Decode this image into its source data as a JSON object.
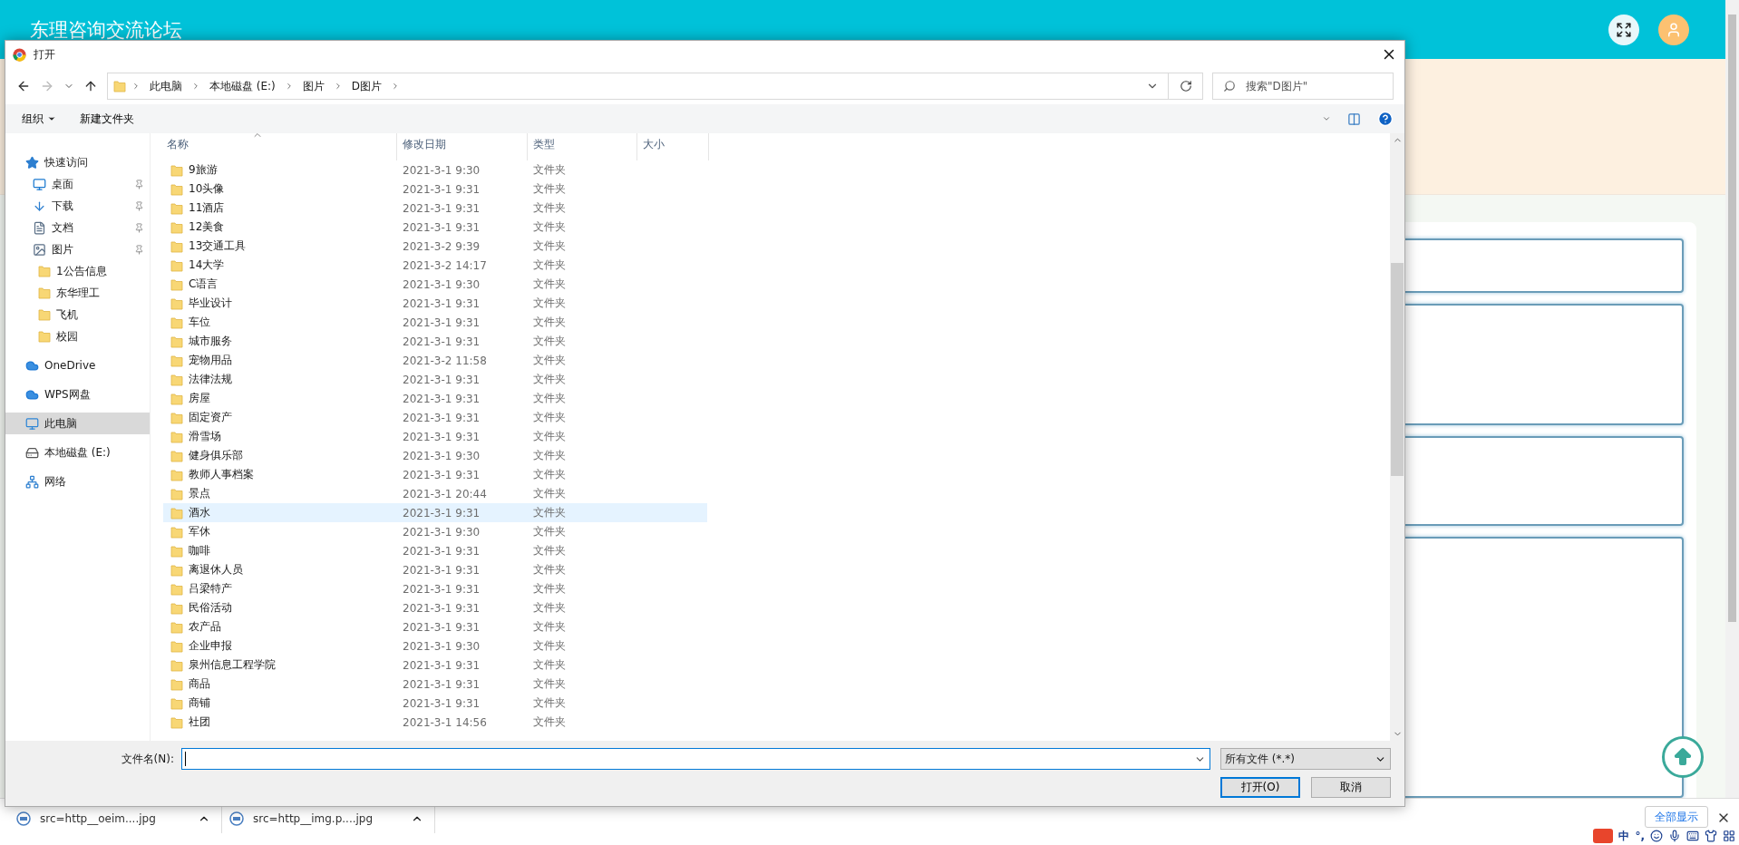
{
  "page": {
    "site_title": "东理咨询交流论坛"
  },
  "dialog": {
    "title": "打开",
    "breadcrumb": [
      "此电脑",
      "本地磁盘 (E:)",
      "图片",
      "D图片"
    ],
    "search": {
      "placeholder": "搜索\"D图片\""
    },
    "toolbar": {
      "organize": "组织",
      "new_folder": "新建文件夹"
    },
    "sidebar": [
      {
        "label": "快速访问",
        "kind": "quick",
        "selected": false,
        "children": [
          {
            "label": "桌面",
            "kind": "desktop",
            "pinned": true,
            "selected": false
          },
          {
            "label": "下载",
            "kind": "download",
            "pinned": true,
            "selected": false
          },
          {
            "label": "文档",
            "kind": "document",
            "pinned": true,
            "selected": false
          },
          {
            "label": "图片",
            "kind": "picture",
            "pinned": true,
            "selected": false
          },
          {
            "label": "1公告信息",
            "kind": "folder",
            "pinned": false,
            "selected": false
          },
          {
            "label": "东华理工",
            "kind": "folder",
            "pinned": false,
            "selected": false
          },
          {
            "label": "飞机",
            "kind": "folder",
            "pinned": false,
            "selected": false
          },
          {
            "label": "校园",
            "kind": "folder",
            "pinned": false,
            "selected": false
          }
        ]
      },
      {
        "label": "OneDrive",
        "kind": "cloud",
        "selected": false
      },
      {
        "label": "WPS网盘",
        "kind": "cloud",
        "selected": false
      },
      {
        "label": "此电脑",
        "kind": "pc",
        "selected": true
      },
      {
        "label": "本地磁盘 (E:)",
        "kind": "drive",
        "selected": false
      },
      {
        "label": "网络",
        "kind": "network",
        "selected": false
      }
    ],
    "columns": [
      "名称",
      "修改日期",
      "类型",
      "大小"
    ],
    "rows": [
      {
        "name": "9旅游",
        "modified": "2021-3-1 9:30",
        "type": "文件夹",
        "hovered": false
      },
      {
        "name": "10头像",
        "modified": "2021-3-1 9:31",
        "type": "文件夹",
        "hovered": false
      },
      {
        "name": "11酒店",
        "modified": "2021-3-1 9:31",
        "type": "文件夹",
        "hovered": false
      },
      {
        "name": "12美食",
        "modified": "2021-3-1 9:31",
        "type": "文件夹",
        "hovered": false
      },
      {
        "name": "13交通工具",
        "modified": "2021-3-2 9:39",
        "type": "文件夹",
        "hovered": false
      },
      {
        "name": "14大学",
        "modified": "2021-3-2 14:17",
        "type": "文件夹",
        "hovered": false
      },
      {
        "name": "C语言",
        "modified": "2021-3-1 9:30",
        "type": "文件夹",
        "hovered": false
      },
      {
        "name": "毕业设计",
        "modified": "2021-3-1 9:31",
        "type": "文件夹",
        "hovered": false
      },
      {
        "name": "车位",
        "modified": "2021-3-1 9:31",
        "type": "文件夹",
        "hovered": false
      },
      {
        "name": "城市服务",
        "modified": "2021-3-1 9:31",
        "type": "文件夹",
        "hovered": false
      },
      {
        "name": "宠物用品",
        "modified": "2021-3-2 11:58",
        "type": "文件夹",
        "hovered": false
      },
      {
        "name": "法律法规",
        "modified": "2021-3-1 9:31",
        "type": "文件夹",
        "hovered": false
      },
      {
        "name": "房屋",
        "modified": "2021-3-1 9:31",
        "type": "文件夹",
        "hovered": false
      },
      {
        "name": "固定资产",
        "modified": "2021-3-1 9:31",
        "type": "文件夹",
        "hovered": false
      },
      {
        "name": "滑雪场",
        "modified": "2021-3-1 9:31",
        "type": "文件夹",
        "hovered": false
      },
      {
        "name": "健身俱乐部",
        "modified": "2021-3-1 9:30",
        "type": "文件夹",
        "hovered": false
      },
      {
        "name": "教师人事档案",
        "modified": "2021-3-1 9:31",
        "type": "文件夹",
        "hovered": false
      },
      {
        "name": "景点",
        "modified": "2021-3-1 20:44",
        "type": "文件夹",
        "hovered": false
      },
      {
        "name": "酒水",
        "modified": "2021-3-1 9:31",
        "type": "文件夹",
        "hovered": true
      },
      {
        "name": "军休",
        "modified": "2021-3-1 9:30",
        "type": "文件夹",
        "hovered": false
      },
      {
        "name": "咖啡",
        "modified": "2021-3-1 9:31",
        "type": "文件夹",
        "hovered": false
      },
      {
        "name": "离退休人员",
        "modified": "2021-3-1 9:31",
        "type": "文件夹",
        "hovered": false
      },
      {
        "name": "吕梁特产",
        "modified": "2021-3-1 9:31",
        "type": "文件夹",
        "hovered": false
      },
      {
        "name": "民俗活动",
        "modified": "2021-3-1 9:31",
        "type": "文件夹",
        "hovered": false
      },
      {
        "name": "农产品",
        "modified": "2021-3-1 9:31",
        "type": "文件夹",
        "hovered": false
      },
      {
        "name": "企业申报",
        "modified": "2021-3-1 9:30",
        "type": "文件夹",
        "hovered": false
      },
      {
        "name": "泉州信息工程学院",
        "modified": "2021-3-1 9:31",
        "type": "文件夹",
        "hovered": false
      },
      {
        "name": "商品",
        "modified": "2021-3-1 9:31",
        "type": "文件夹",
        "hovered": false
      },
      {
        "name": "商铺",
        "modified": "2021-3-1 9:31",
        "type": "文件夹",
        "hovered": false
      },
      {
        "name": "社团",
        "modified": "2021-3-1 14:56",
        "type": "文件夹",
        "hovered": false
      }
    ],
    "filename": {
      "label": "文件名(N):"
    },
    "filter": "所有文件 (*.*)",
    "buttons": [
      {
        "label": "打开(O)",
        "default": true
      },
      {
        "label": "取消",
        "default": false
      }
    ]
  },
  "downloads": {
    "items": [
      "src=http__oeim....jpg",
      "src=http__img.p....jpg"
    ],
    "show_all": "全部显示"
  },
  "tray": {
    "ime": "中",
    "punct": "°,"
  }
}
